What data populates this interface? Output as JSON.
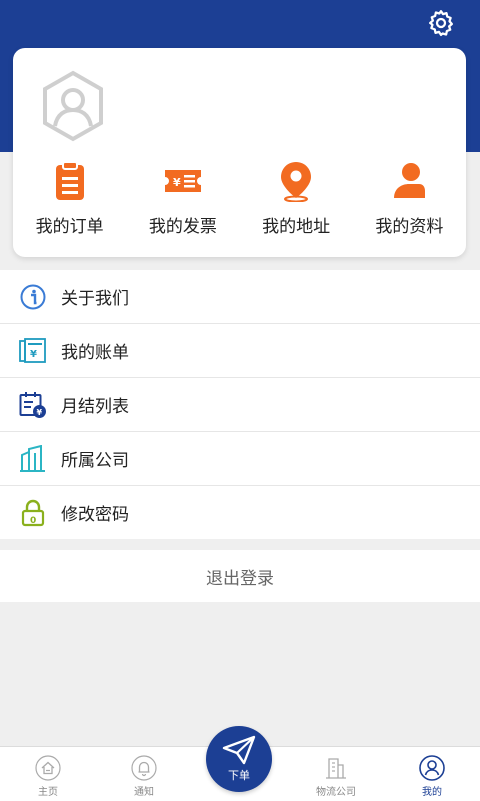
{
  "header": {
    "settings_icon": "gear-icon"
  },
  "profile": {
    "avatar_icon": "user-hexagon-icon"
  },
  "quick_actions": [
    {
      "label": "我的订单",
      "icon": "clipboard-icon",
      "color": "#f26b21"
    },
    {
      "label": "我的发票",
      "icon": "ticket-icon",
      "color": "#f26b21"
    },
    {
      "label": "我的地址",
      "icon": "location-pin-icon",
      "color": "#f26b21"
    },
    {
      "label": "我的资料",
      "icon": "person-icon",
      "color": "#f26b21"
    }
  ],
  "menu": [
    {
      "label": "关于我们",
      "icon": "info-icon",
      "color": "#3a7bd5"
    },
    {
      "label": "我的账单",
      "icon": "bill-icon",
      "color": "#1f9bbf"
    },
    {
      "label": "月结列表",
      "icon": "calendar-yen-icon",
      "color": "#1c3f94"
    },
    {
      "label": "所属公司",
      "icon": "building-icon",
      "color": "#2bb5c4"
    },
    {
      "label": "修改密码",
      "icon": "lock-icon",
      "color": "#8ab01d"
    }
  ],
  "logout_label": "退出登录",
  "tabbar": {
    "tabs": [
      {
        "label": "主页",
        "icon": "home-icon"
      },
      {
        "label": "通知",
        "icon": "bell-icon"
      },
      {
        "label": "物流公司",
        "icon": "company-icon"
      },
      {
        "label": "我的",
        "icon": "user-icon",
        "active": true
      }
    ],
    "center_label": "下单",
    "center_icon": "paper-plane-icon"
  },
  "colors": {
    "primary": "#1c3f94",
    "accent": "#f26b21",
    "background": "#efefef"
  }
}
